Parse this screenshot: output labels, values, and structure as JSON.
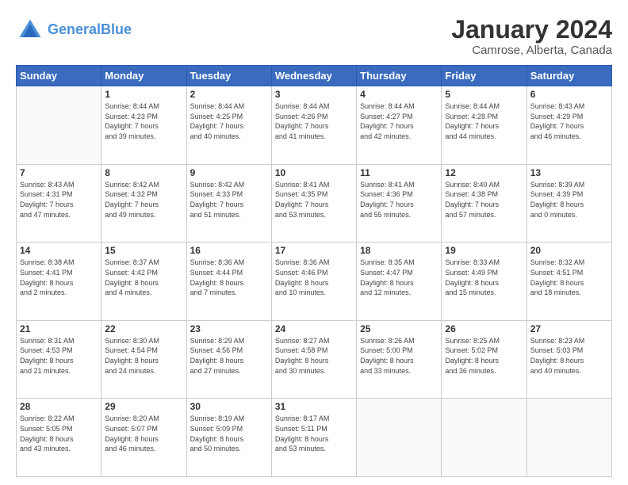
{
  "header": {
    "logo_line1": "General",
    "logo_line2": "Blue",
    "title": "January 2024",
    "subtitle": "Camrose, Alberta, Canada"
  },
  "days_of_week": [
    "Sunday",
    "Monday",
    "Tuesday",
    "Wednesday",
    "Thursday",
    "Friday",
    "Saturday"
  ],
  "weeks": [
    [
      {
        "day": "",
        "info": ""
      },
      {
        "day": "1",
        "info": "Sunrise: 8:44 AM\nSunset: 4:23 PM\nDaylight: 7 hours\nand 39 minutes."
      },
      {
        "day": "2",
        "info": "Sunrise: 8:44 AM\nSunset: 4:25 PM\nDaylight: 7 hours\nand 40 minutes."
      },
      {
        "day": "3",
        "info": "Sunrise: 8:44 AM\nSunset: 4:26 PM\nDaylight: 7 hours\nand 41 minutes."
      },
      {
        "day": "4",
        "info": "Sunrise: 8:44 AM\nSunset: 4:27 PM\nDaylight: 7 hours\nand 42 minutes."
      },
      {
        "day": "5",
        "info": "Sunrise: 8:44 AM\nSunset: 4:28 PM\nDaylight: 7 hours\nand 44 minutes."
      },
      {
        "day": "6",
        "info": "Sunrise: 8:43 AM\nSunset: 4:29 PM\nDaylight: 7 hours\nand 46 minutes."
      }
    ],
    [
      {
        "day": "7",
        "info": "Sunrise: 8:43 AM\nSunset: 4:31 PM\nDaylight: 7 hours\nand 47 minutes."
      },
      {
        "day": "8",
        "info": "Sunrise: 8:42 AM\nSunset: 4:32 PM\nDaylight: 7 hours\nand 49 minutes."
      },
      {
        "day": "9",
        "info": "Sunrise: 8:42 AM\nSunset: 4:33 PM\nDaylight: 7 hours\nand 51 minutes."
      },
      {
        "day": "10",
        "info": "Sunrise: 8:41 AM\nSunset: 4:35 PM\nDaylight: 7 hours\nand 53 minutes."
      },
      {
        "day": "11",
        "info": "Sunrise: 8:41 AM\nSunset: 4:36 PM\nDaylight: 7 hours\nand 55 minutes."
      },
      {
        "day": "12",
        "info": "Sunrise: 8:40 AM\nSunset: 4:38 PM\nDaylight: 7 hours\nand 57 minutes."
      },
      {
        "day": "13",
        "info": "Sunrise: 8:39 AM\nSunset: 4:39 PM\nDaylight: 8 hours\nand 0 minutes."
      }
    ],
    [
      {
        "day": "14",
        "info": "Sunrise: 8:38 AM\nSunset: 4:41 PM\nDaylight: 8 hours\nand 2 minutes."
      },
      {
        "day": "15",
        "info": "Sunrise: 8:37 AM\nSunset: 4:42 PM\nDaylight: 8 hours\nand 4 minutes."
      },
      {
        "day": "16",
        "info": "Sunrise: 8:36 AM\nSunset: 4:44 PM\nDaylight: 8 hours\nand 7 minutes."
      },
      {
        "day": "17",
        "info": "Sunrise: 8:36 AM\nSunset: 4:46 PM\nDaylight: 8 hours\nand 10 minutes."
      },
      {
        "day": "18",
        "info": "Sunrise: 8:35 AM\nSunset: 4:47 PM\nDaylight: 8 hours\nand 12 minutes."
      },
      {
        "day": "19",
        "info": "Sunrise: 8:33 AM\nSunset: 4:49 PM\nDaylight: 8 hours\nand 15 minutes."
      },
      {
        "day": "20",
        "info": "Sunrise: 8:32 AM\nSunset: 4:51 PM\nDaylight: 8 hours\nand 18 minutes."
      }
    ],
    [
      {
        "day": "21",
        "info": "Sunrise: 8:31 AM\nSunset: 4:53 PM\nDaylight: 8 hours\nand 21 minutes."
      },
      {
        "day": "22",
        "info": "Sunrise: 8:30 AM\nSunset: 4:54 PM\nDaylight: 8 hours\nand 24 minutes."
      },
      {
        "day": "23",
        "info": "Sunrise: 8:29 AM\nSunset: 4:56 PM\nDaylight: 8 hours\nand 27 minutes."
      },
      {
        "day": "24",
        "info": "Sunrise: 8:27 AM\nSunset: 4:58 PM\nDaylight: 8 hours\nand 30 minutes."
      },
      {
        "day": "25",
        "info": "Sunrise: 8:26 AM\nSunset: 5:00 PM\nDaylight: 8 hours\nand 33 minutes."
      },
      {
        "day": "26",
        "info": "Sunrise: 8:25 AM\nSunset: 5:02 PM\nDaylight: 8 hours\nand 36 minutes."
      },
      {
        "day": "27",
        "info": "Sunrise: 8:23 AM\nSunset: 5:03 PM\nDaylight: 8 hours\nand 40 minutes."
      }
    ],
    [
      {
        "day": "28",
        "info": "Sunrise: 8:22 AM\nSunset: 5:05 PM\nDaylight: 8 hours\nand 43 minutes."
      },
      {
        "day": "29",
        "info": "Sunrise: 8:20 AM\nSunset: 5:07 PM\nDaylight: 8 hours\nand 46 minutes."
      },
      {
        "day": "30",
        "info": "Sunrise: 8:19 AM\nSunset: 5:09 PM\nDaylight: 8 hours\nand 50 minutes."
      },
      {
        "day": "31",
        "info": "Sunrise: 8:17 AM\nSunset: 5:11 PM\nDaylight: 8 hours\nand 53 minutes."
      },
      {
        "day": "",
        "info": ""
      },
      {
        "day": "",
        "info": ""
      },
      {
        "day": "",
        "info": ""
      }
    ]
  ]
}
